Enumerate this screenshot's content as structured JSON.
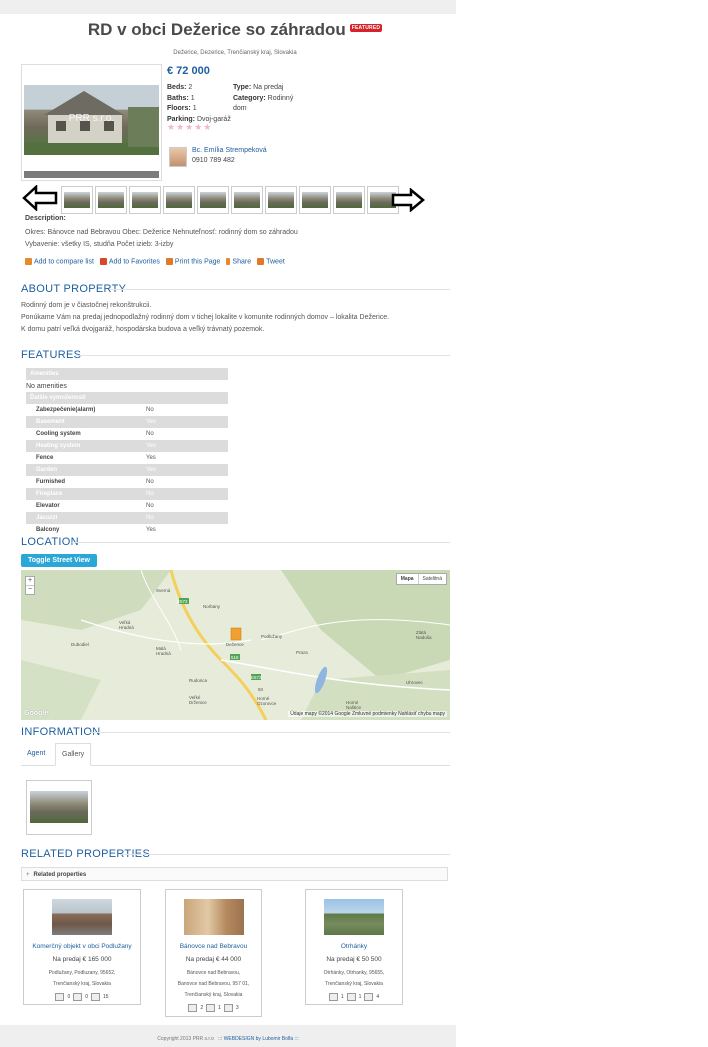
{
  "listing": {
    "title": "RD v obci Dežerice so záhradou",
    "featured_badge": "FEATURED",
    "address": "Dežerice, Dezerice, Trenčianský kraj, Slovakia",
    "watermark": "PRR s.r.o.",
    "price": "€ 72 000",
    "specs": {
      "beds_label": "Beds:",
      "beds": "2",
      "baths_label": "Baths:",
      "baths": "1",
      "floors_label": "Floors:",
      "floors": "1",
      "parking_label": "Parking:",
      "parking": "Dvoj-garáž",
      "type_label": "Type:",
      "type": "Na predaj",
      "category_label": "Category:",
      "category": "Rodinný dom"
    },
    "rating_stars": "★★★★★",
    "agent_name": "Bc. Emília Strempeková",
    "agent_phone": "0910 789 482",
    "description_label": "Description:",
    "description": "Okres: Bánovce nad Bebravou Obec: Dežerice Nehnuteľnosť: rodinný dom so záhradou Vybavenie: všetky IS, studňa Počet izieb: 3-izby",
    "actions": {
      "compare": "Add to compare list",
      "favorites": "Add to Favorites",
      "print": "Print this Page",
      "share": "Share",
      "tweet": "Tweet"
    }
  },
  "about": {
    "heading": "ABOUT PROPERTY",
    "line1": "Rodinný dom je v čiastočnej rekonštrukcii.",
    "line2": "Ponúkame Vám na predaj jednopodlažný rodinný dom v tichej lokalite v komunite rodinných domov – lokalita Dežerice.",
    "line3": "K domu patrí veľká dvojgaráž, hospodárska budova a veľký trávnatý pozemok."
  },
  "features": {
    "heading": "FEATURES",
    "amenities_label": "Amenities",
    "no_amenities": "No amenities",
    "other_label": "Ďalšie vymoženosti",
    "rows": [
      {
        "name": "Zabezpečenie(alarm)",
        "value": "No"
      },
      {
        "name": "Basement",
        "value": "Yes"
      },
      {
        "name": "Cooling system",
        "value": "No"
      },
      {
        "name": "Heating system",
        "value": "Yes"
      },
      {
        "name": "Fence",
        "value": "Yes"
      },
      {
        "name": "Garden",
        "value": "Yes"
      },
      {
        "name": "Furnished",
        "value": "No"
      },
      {
        "name": "Fireplace",
        "value": "No"
      },
      {
        "name": "Elevator",
        "value": "No"
      },
      {
        "name": "Jacuzzi",
        "value": "No"
      },
      {
        "name": "Balcony",
        "value": "Yes"
      }
    ]
  },
  "location": {
    "heading": "LOCATION",
    "toggle_label": "Toggle Street View",
    "map_btn": "Mapa",
    "sat_btn": "Satelitná",
    "zoom_in": "+",
    "zoom_out": "−",
    "google": "Google",
    "footer": "Údaje mapy ©2014 Google   Zmluvné podmienky   Nahlásiť chybu mapy",
    "towns": [
      "Sverná",
      "Norbany",
      "Veľká Hradná",
      "Dubodiel",
      "Malá Hradná",
      "Dežerice",
      "Podlužany",
      "Praza",
      "Rudorica",
      "Veľké Drženice",
      "Horné Ozorovce",
      "Horné Naštice",
      "Uhrovec",
      "Zlatá Nadoša"
    ],
    "road_labels": [
      "E572",
      "518",
      "E572",
      "50"
    ]
  },
  "information": {
    "heading": "INFORMATION",
    "tab_agent": "Agent",
    "tab_gallery": "Gallery"
  },
  "related": {
    "heading": "RELATED PROPERTIES",
    "bar_label": "Related properties",
    "cards": [
      {
        "title": "Komerčný objekt v obci Podlužany",
        "price": "Na predaj € 165 000",
        "loc1": "Podlužany, Podluzany, 95652,",
        "loc2": "Trenčianský kraj, Slovakia",
        "beds": "0",
        "baths": "0",
        "garage": "15"
      },
      {
        "title": "Bánovce nad Bebravou",
        "price": "Na predaj € 44 000",
        "loc1": "Bánovce nad Bebravou,",
        "loc2": "Banovce nad Bebravou, 957 01,",
        "loc3": "Trenčianský kraj, Slovakia",
        "beds": "2",
        "baths": "1",
        "garage": "3"
      },
      {
        "title": "Otrhánky",
        "price": "Na predaj € 50 500",
        "loc1": "Otrhánky, Otrhanky, 95655,",
        "loc2": "Trenčianský kraj, Slovakia",
        "beds": "1",
        "baths": "1",
        "garage": "4"
      }
    ]
  },
  "footer": {
    "copyright": "Copyright 2013 PRR s.r.o",
    "credit": "::: WEBDESIGN by Lubomir Bolfa :::"
  },
  "colors": {
    "accent": "#1d5fa0",
    "toggle": "#2aa7d6",
    "featured": "#d6232a"
  }
}
